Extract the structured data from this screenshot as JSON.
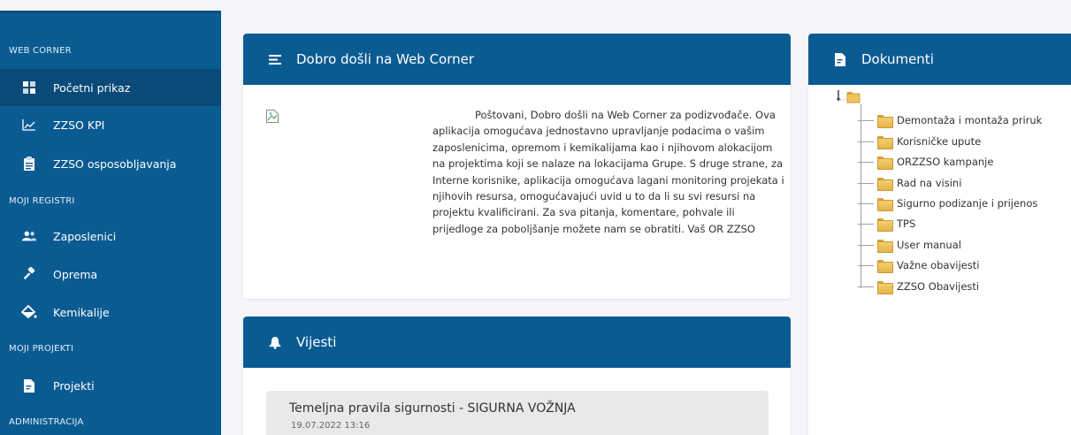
{
  "sidebar": {
    "sections": [
      {
        "title": "WEB CORNER"
      },
      {
        "title": "MOJI REGISTRI"
      },
      {
        "title": "MOJI PROJEKTI"
      },
      {
        "title": "ADMINISTRACIJA"
      }
    ],
    "items": [
      {
        "label": "Početni prikaz",
        "icon": "dashboard-icon",
        "active": true
      },
      {
        "label": "ZZSO KPI",
        "icon": "line-chart-icon"
      },
      {
        "label": "ZZSO osposobljavanja",
        "icon": "clipboard-icon"
      },
      {
        "label": "Zaposlenici",
        "icon": "users-icon"
      },
      {
        "label": "Oprema",
        "icon": "gavel-icon"
      },
      {
        "label": "Kemikalije",
        "icon": "fill-drip-icon"
      },
      {
        "label": "Projekti",
        "icon": "document-icon"
      }
    ]
  },
  "welcome": {
    "title": "Dobro došli na  Web Corner",
    "icon": "menu-icon",
    "text": "Poštovani, Dobro došli na  Web Corner za podizvođače. Ova aplikacija omogućava jednostavno upravljanje podacima o vašim zaposlenicima, opremom i kemikalijama kao i njihovom alokacijom na projektima koji se nalaze na lokacijama Grupe.  S druge strane, za Interne korisnike, aplikacija omogućava lagani monitoring projekata i njihovih resursa, omogućavajući uvid u to da li su svi resursi na projektu kvalificirani. Za sva pitanja, komentare, pohvale ili prijedloge za poboljšanje možete nam se obratiti. Vaš  OR ZZSO"
  },
  "news": {
    "title": "Vijesti",
    "icon": "bell-icon",
    "items": [
      {
        "title": "Temeljna pravila sigurnosti - SIGURNA VOŽNJA",
        "date": "19.07.2022 13:16"
      }
    ]
  },
  "documents": {
    "title": "Dokumenti",
    "icon": "file-icon",
    "folders": [
      "Demontaža i montaža priruk",
      "Korisničke upute",
      "ORZZSO kampanje",
      "Rad na visini",
      "Sigurno podizanje i prijenos",
      "TPS",
      "User manual",
      "Važne obavijesti",
      "ZZSO Obavijesti"
    ]
  },
  "colors": {
    "primary": "#0b5b93",
    "sidebar_active": "#0a4a78",
    "background": "#f4f5f8"
  }
}
